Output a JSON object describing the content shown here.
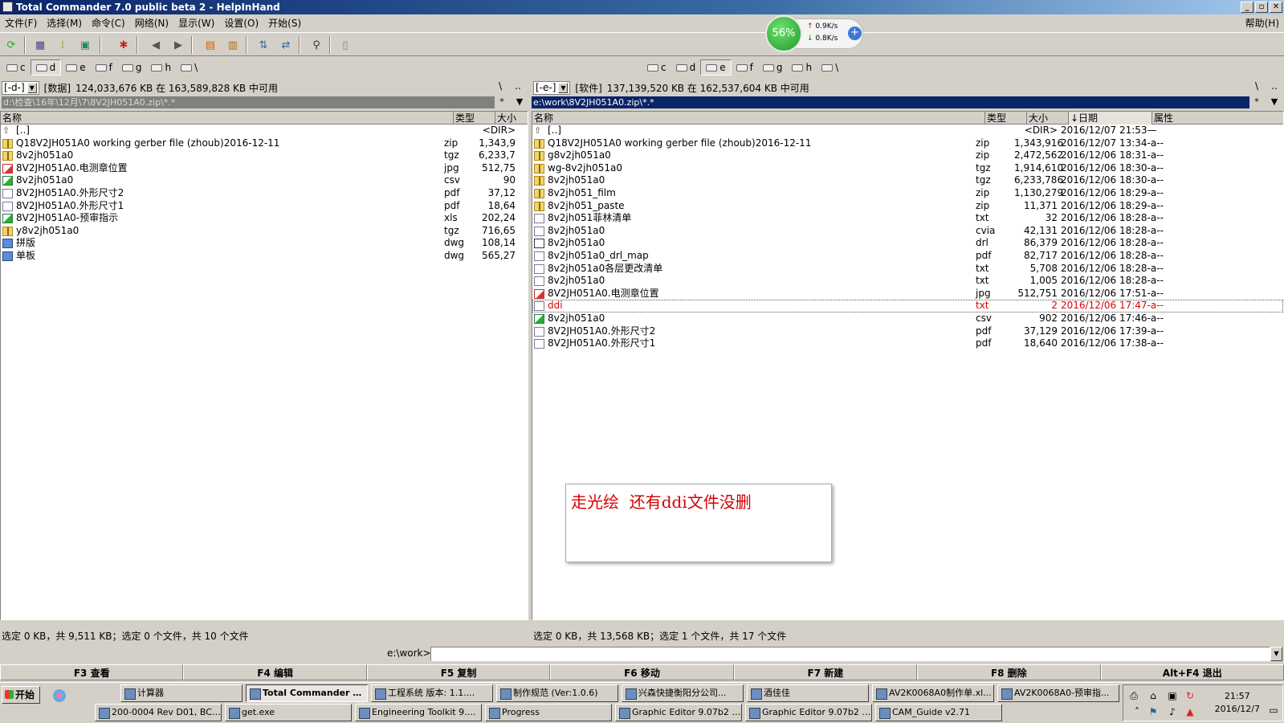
{
  "window": {
    "title": "Total Commander 7.0 public beta 2 - HelpInHand",
    "controls": [
      "_",
      "▫",
      "✕"
    ]
  },
  "menu": {
    "items": [
      "文件(F)",
      "选择(M)",
      "命令(C)",
      "网络(N)",
      "显示(W)",
      "设置(O)",
      "开始(S)"
    ],
    "help": "帮助(H)"
  },
  "netwidget": {
    "percent": "56%",
    "up": "0.9K/s",
    "down": "0.8K/s",
    "plus": "+"
  },
  "left": {
    "drives": [
      "c",
      "d",
      "e",
      "f",
      "g",
      "h",
      "\\"
    ],
    "active_drive": "d",
    "drive_select": "[-d-]",
    "volume": "[数据]",
    "free": "124,033,676 KB 在 163,589,828 KB 中可用",
    "path": "d:\\检查\\16年\\12月\\7\\8V2JH051A0.zip\\*.*",
    "headers": {
      "name": "名称",
      "type": "类型",
      "size": "大小"
    },
    "rows": [
      {
        "icon": "up",
        "name": "[..]",
        "type": "",
        "size": "<DIR>"
      },
      {
        "icon": "zip",
        "name": "Q18V2JH051A0 working gerber file (zhoub)2016-12-11",
        "type": "zip",
        "size": "1,343,9"
      },
      {
        "icon": "zip",
        "name": "8v2jh051a0",
        "type": "tgz",
        "size": "6,233,78"
      },
      {
        "icon": "img",
        "name": "8V2JH051A0.电测章位置",
        "type": "jpg",
        "size": "512,75"
      },
      {
        "icon": "xls",
        "name": "8v2jh051a0",
        "type": "csv",
        "size": "90"
      },
      {
        "icon": "file",
        "name": "8V2JH051A0.外形尺寸2",
        "type": "pdf",
        "size": "37,12"
      },
      {
        "icon": "file",
        "name": "8V2JH051A0.外形尺寸1",
        "type": "pdf",
        "size": "18,64"
      },
      {
        "icon": "xls",
        "name": "8V2JH051A0-预审指示",
        "type": "xls",
        "size": "202,24"
      },
      {
        "icon": "zip",
        "name": "y8v2jh051a0",
        "type": "tgz",
        "size": "716,65"
      },
      {
        "icon": "cad",
        "name": "拼版",
        "type": "dwg",
        "size": "108,14"
      },
      {
        "icon": "cad",
        "name": "单板",
        "type": "dwg",
        "size": "565,27"
      }
    ],
    "status": "选定 0 KB，共 9,511 KB；选定 0 个文件，共 10 个文件"
  },
  "right": {
    "drives": [
      "c",
      "d",
      "e",
      "f",
      "g",
      "h",
      "\\"
    ],
    "active_drive": "e",
    "drive_select": "[-e-]",
    "volume": "[软件]",
    "free": "137,139,520 KB 在 162,537,604 KB 中可用",
    "path": "e:\\work\\8V2JH051A0.zip\\*.*",
    "headers": {
      "name": "名称",
      "type": "类型",
      "size": "大小",
      "date": "↓日期",
      "attr": "属性"
    },
    "rows": [
      {
        "icon": "up",
        "name": "[..]",
        "type": "",
        "size": "<DIR>",
        "date": "2016/12/07 21:53—"
      },
      {
        "icon": "zip",
        "name": "Q18V2JH051A0 working gerber file (zhoub)2016-12-11",
        "type": "zip",
        "size": "1,343,916",
        "date": "2016/12/07 13:34-a--"
      },
      {
        "icon": "zip",
        "name": "g8v2jh051a0",
        "type": "zip",
        "size": "2,472,562",
        "date": "2016/12/06 18:31-a--"
      },
      {
        "icon": "zip",
        "name": "wg-8v2jh051a0",
        "type": "tgz",
        "size": "1,914,610",
        "date": "2016/12/06 18:30-a--"
      },
      {
        "icon": "zip",
        "name": "8v2jh051a0",
        "type": "tgz",
        "size": "6,233,786",
        "date": "2016/12/06 18:30-a--"
      },
      {
        "icon": "zip",
        "name": "8v2jh051_film",
        "type": "zip",
        "size": "1,130,279",
        "date": "2016/12/06 18:29-a--"
      },
      {
        "icon": "zip",
        "name": "8v2jh051_paste",
        "type": "zip",
        "size": "11,371",
        "date": "2016/12/06 18:29-a--"
      },
      {
        "icon": "file",
        "name": "8v2jh051菲林清单",
        "type": "txt",
        "size": "32",
        "date": "2016/12/06 18:28-a--"
      },
      {
        "icon": "file",
        "name": "8v2jh051a0",
        "type": "cvia",
        "size": "42,131",
        "date": "2016/12/06 18:28-a--"
      },
      {
        "icon": "app",
        "name": "8v2jh051a0",
        "type": "drl",
        "size": "86,379",
        "date": "2016/12/06 18:28-a--"
      },
      {
        "icon": "file",
        "name": "8v2jh051a0_drl_map",
        "type": "pdf",
        "size": "82,717",
        "date": "2016/12/06 18:28-a--"
      },
      {
        "icon": "file",
        "name": "8v2jh051a0各层更改清单",
        "type": "txt",
        "size": "5,708",
        "date": "2016/12/06 18:28-a--"
      },
      {
        "icon": "file",
        "name": "8v2jh051a0",
        "type": "txt",
        "size": "1,005",
        "date": "2016/12/06 18:28-a--"
      },
      {
        "icon": "img",
        "name": "8V2JH051A0.电测章位置",
        "type": "jpg",
        "size": "512,751",
        "date": "2016/12/06 17:51-a--"
      },
      {
        "icon": "file",
        "name": "ddi",
        "type": "txt",
        "size": "2",
        "date": "2016/12/06 17:47-a--",
        "red": true
      },
      {
        "icon": "xls",
        "name": "8v2jh051a0",
        "type": "csv",
        "size": "902",
        "date": "2016/12/06 17:46-a--"
      },
      {
        "icon": "file",
        "name": "8V2JH051A0.外形尺寸2",
        "type": "pdf",
        "size": "37,129",
        "date": "2016/12/06 17:39-a--"
      },
      {
        "icon": "file",
        "name": "8V2JH051A0.外形尺寸1",
        "type": "pdf",
        "size": "18,640",
        "date": "2016/12/06 17:38-a--"
      }
    ],
    "status": "选定 0 KB，共 13,568 KB；选定 1 个文件，共 17 个文件"
  },
  "note": {
    "text": "走光绘  还有ddi文件没删"
  },
  "cmdline": {
    "label": "e:\\work>",
    "value": ""
  },
  "fkeys": [
    "F3 查看",
    "F4 编辑",
    "F5 复制",
    "F6 移动",
    "F7 新建",
    "F8 删除",
    "Alt+F4 退出"
  ],
  "taskbar": {
    "start": "开始",
    "row1": [
      "计算器",
      "Total Commander 7....",
      "工程系统 版本: 1.1....",
      "制作规范 (Ver:1.0.6)",
      "兴森快捷衡阳分公司...",
      "酒佳佳",
      "AV2K0068A0制作单.xl...",
      "AV2K0068A0-预审指..."
    ],
    "row2": [
      "200-0004 Rev D01, BC8 ...",
      "get.exe",
      "Engineering Toolkit 9.07...",
      "Progress",
      "Graphic Editor 9.07b2 (0...",
      "Graphic Editor 9.07b2 (0...",
      "CAM_Guide v2.71"
    ],
    "clock_time": "21:57",
    "clock_date": "2016/12/7"
  }
}
